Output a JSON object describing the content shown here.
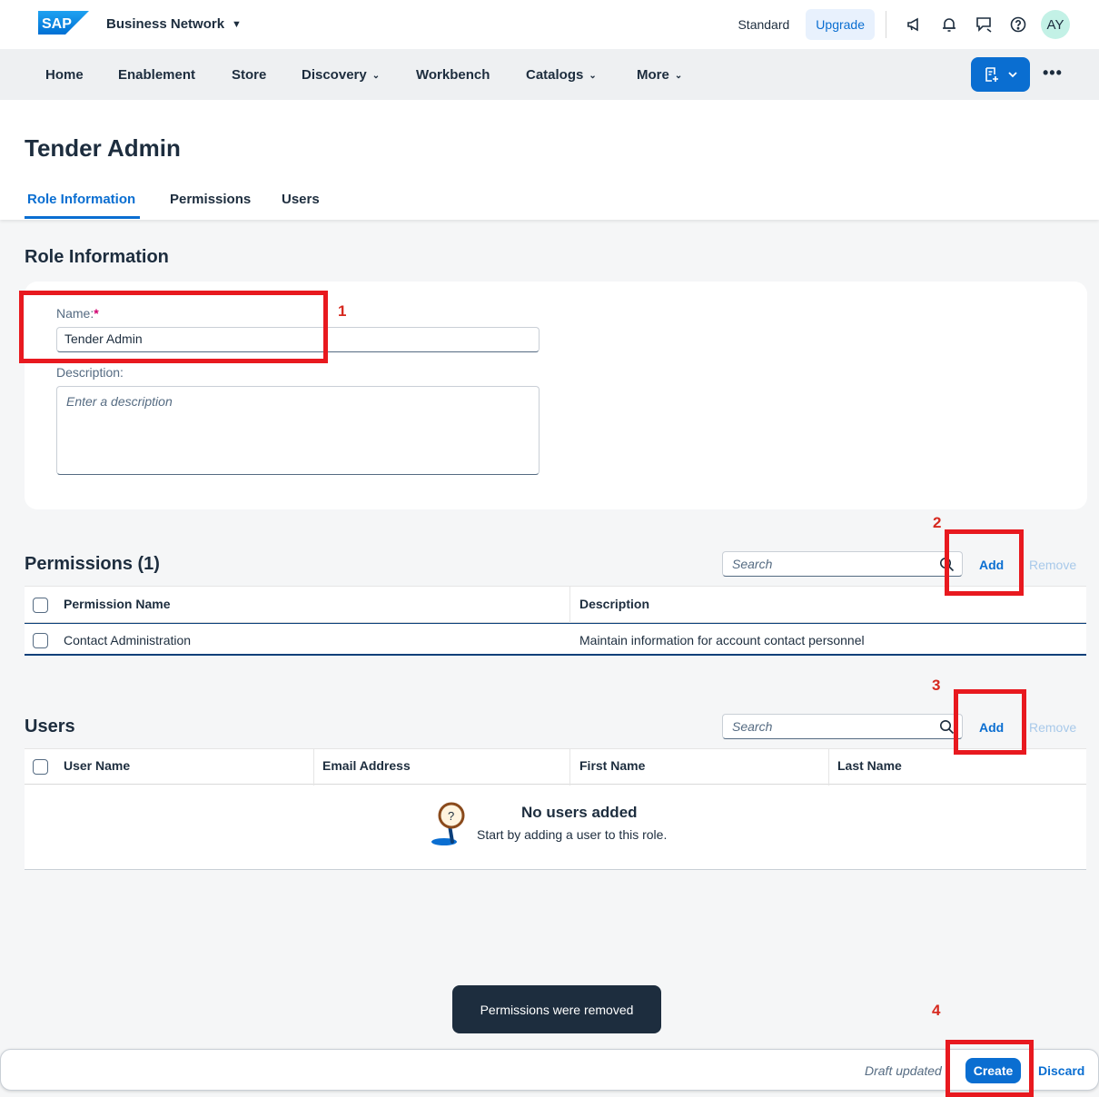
{
  "shell": {
    "logo_text": "SAP",
    "product_name": "Business Network",
    "product_caret": "▼",
    "standard_label": "Standard",
    "upgrade_label": "Upgrade",
    "avatar_initials": "AY",
    "icons": [
      "megaphone-icon",
      "bell-icon",
      "feedback-icon",
      "help-icon"
    ]
  },
  "nav": {
    "items": [
      "Home",
      "Enablement",
      "Store",
      "Discovery",
      "Workbench",
      "Catalogs",
      "More"
    ],
    "more_actions": "•••"
  },
  "page": {
    "title": "Tender Admin",
    "tabs": [
      "Role Information",
      "Permissions",
      "Users"
    ],
    "active_tab": "Role Information"
  },
  "role_info": {
    "section_title": "Role Information",
    "name_label": "Name:",
    "required_mark": "*",
    "name_value": "Tender Admin",
    "description_label": "Description:",
    "description_placeholder": "Enter a description"
  },
  "permissions": {
    "section_title": "Permissions (1)",
    "search_placeholder": "Search",
    "add_label": "Add",
    "remove_label": "Remove",
    "columns": [
      "Permission Name",
      "Description"
    ],
    "rows": [
      {
        "name": "Contact Administration",
        "description": "Maintain information for account contact personnel"
      }
    ]
  },
  "users": {
    "section_title": "Users",
    "search_placeholder": "Search",
    "add_label": "Add",
    "remove_label": "Remove",
    "columns": [
      "User Name",
      "Email Address",
      "First Name",
      "Last Name"
    ],
    "empty_title": "No users added",
    "empty_text": "Start by adding a user to this role."
  },
  "toast": {
    "message": "Permissions were removed"
  },
  "footer": {
    "draft_status": "Draft updated",
    "create_label": "Create",
    "discard_label": "Discard"
  },
  "annotations": [
    "1",
    "2",
    "3",
    "4"
  ],
  "colors": {
    "accent": "#0a6ed1",
    "annotation_red": "#e8191f",
    "toast_bg": "#1d2d3e",
    "avatar_bg": "#c3f1e6"
  }
}
